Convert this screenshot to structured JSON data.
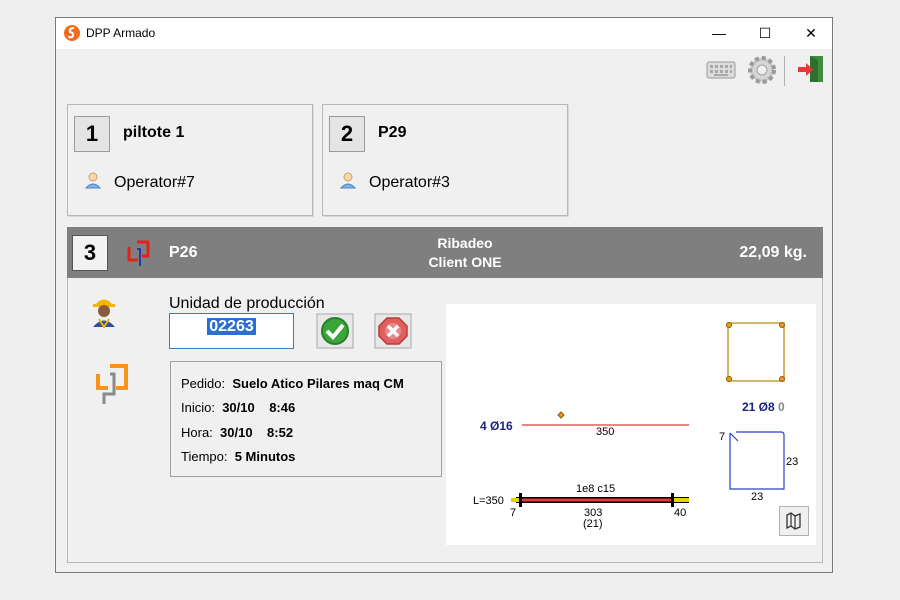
{
  "window": {
    "title": "DPP Armado"
  },
  "titlebar_buttons": {
    "minimize": "—",
    "maximize": "☐",
    "close": "✕"
  },
  "toolbar": {
    "keyboard": "keyboard-icon",
    "settings": "gear-icon",
    "exit": "exit-icon"
  },
  "cards": [
    {
      "number": "1",
      "title": "piltote 1",
      "operator": "Operator#7"
    },
    {
      "number": "2",
      "title": "P29",
      "operator": "Operator#3"
    }
  ],
  "active": {
    "number": "3",
    "code": "P26",
    "location": "Ribadeo",
    "client": "Client ONE",
    "weight": "22,09 kg.",
    "unidad_label": "Unidad de producción",
    "unidad_value": "02263",
    "pedido_label": "Pedido:",
    "pedido_value": "Suelo Atico Pilares maq CM",
    "inicio_label": "Inicio:",
    "inicio_date": "30/10",
    "inicio_time": "8:46",
    "hora_label": "Hora:",
    "hora_date": "30/10",
    "hora_time": "8:52",
    "tiempo_label": "Tiempo:",
    "tiempo_value": "5 Minutos"
  },
  "drawing": {
    "bar_count": "4 Ø16",
    "bar_length": "350",
    "stirrup_count": "21 Ø8",
    "stirrup_suffix": "0",
    "stirrup_hook": "7",
    "stirrup_side": "23",
    "stirrup_bottom": "23",
    "spacing_label": "1e8 c15",
    "length_label": "L=350",
    "left_offset": "7",
    "mid_length": "303",
    "mid_count": "(21)",
    "right_offset": "40"
  },
  "colors": {
    "band": "#7f7f7f",
    "accent_blue": "#1a237e",
    "bar_red": "#e53935",
    "selection": "#2f6ed1"
  }
}
